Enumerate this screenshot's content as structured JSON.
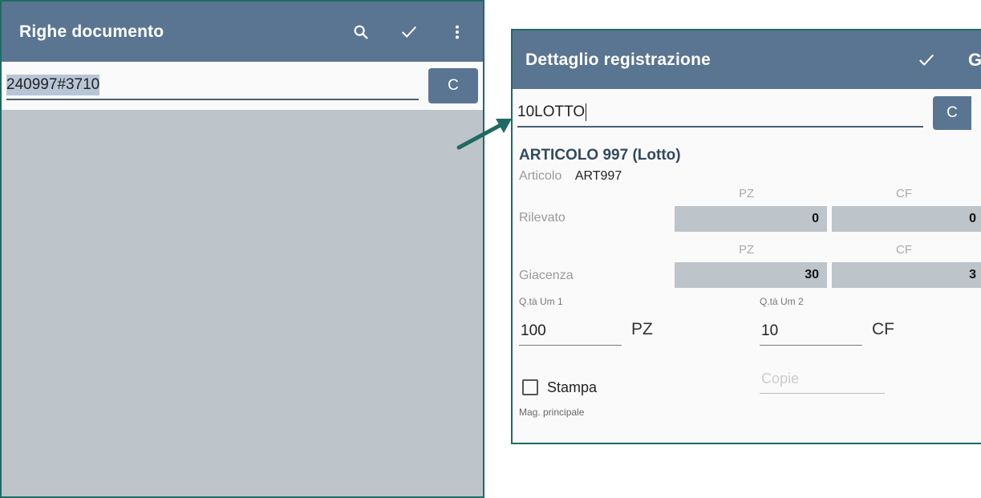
{
  "left_screen": {
    "title": "Righe documento",
    "icons": [
      "search-icon",
      "check-icon",
      "more-vert-icon"
    ],
    "input_value": "240997#3710",
    "clear_button": "C"
  },
  "right_screen": {
    "title": "Dettaglio registrazione",
    "action_letter": "G",
    "input_value": "10LOTTO",
    "clear_button": "C",
    "article_title": "ARTICOLO 997 (Lotto)",
    "article_label": "Articolo",
    "article_value": "ART997",
    "rilevato": {
      "label": "Rilevato",
      "unit1": "PZ",
      "value1": "0",
      "unit2": "CF",
      "value2": "0"
    },
    "giacenza": {
      "label": "Giacenza",
      "unit1": "PZ",
      "value1": "30",
      "unit2": "CF",
      "value2": "3"
    },
    "qty1_label": "Q.tà Um 1",
    "qty1_value": "100",
    "qty1_unit": "PZ",
    "qty2_label": "Q.tà Um 2",
    "qty2_value": "10",
    "qty2_unit": "CF",
    "stampa_label": "Stampa",
    "copie_placeholder": "Copie",
    "mag_label": "Mag. principale"
  },
  "colors": {
    "topbar": "#5a7591",
    "border": "#1f6b63",
    "body_gray": "#bdc4ca",
    "arrow": "#1f6b63"
  }
}
